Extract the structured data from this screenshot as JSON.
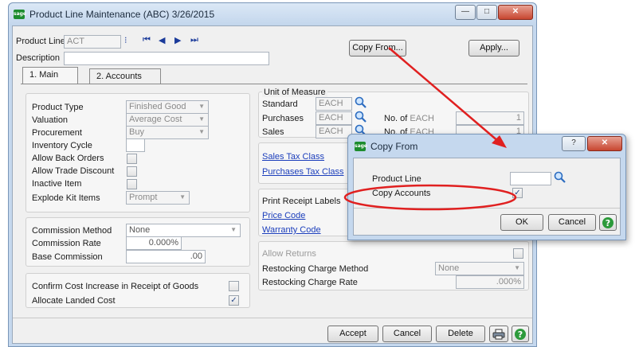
{
  "window": {
    "title": "Product Line Maintenance (ABC) 3/26/2015",
    "minimize": "—",
    "maximize": "□",
    "close": "✕"
  },
  "header": {
    "product_line_label": "Product Line",
    "product_line_value": "ACT",
    "description_label": "Description",
    "description_value": "",
    "copy_from_button": "Copy From...",
    "apply_button": "Apply..."
  },
  "tabs": [
    {
      "label": "1. Main"
    },
    {
      "label": "2. Accounts"
    }
  ],
  "main": {
    "product_type_label": "Product Type",
    "product_type_value": "Finished Good",
    "valuation_label": "Valuation",
    "valuation_value": "Average Cost",
    "procurement_label": "Procurement",
    "procurement_value": "Buy",
    "inventory_cycle_label": "Inventory Cycle",
    "inventory_cycle_value": "",
    "allow_back_orders_label": "Allow Back Orders",
    "allow_back_orders_checked": false,
    "allow_trade_discount_label": "Allow Trade Discount",
    "allow_trade_discount_checked": false,
    "inactive_item_label": "Inactive Item",
    "inactive_item_checked": false,
    "explode_kit_items_label": "Explode Kit Items",
    "explode_kit_items_value": "Prompt",
    "commission_method_label": "Commission Method",
    "commission_method_value": "None",
    "commission_rate_label": "Commission Rate",
    "commission_rate_value": "0.000%",
    "base_commission_label": "Base Commission",
    "base_commission_value": ".00",
    "confirm_cost_label": "Confirm Cost Increase in Receipt of Goods",
    "confirm_cost_checked": false,
    "allocate_landed_cost_label": "Allocate Landed Cost",
    "allocate_landed_cost_checked": true
  },
  "uom": {
    "group_label": "Unit of Measure",
    "standard_label": "Standard",
    "standard_value": "EACH",
    "purchases_label": "Purchases",
    "purchases_value": "EACH",
    "sales_label": "Sales",
    "sales_value": "EACH",
    "no_of_label_1": "No. of",
    "no_of_unit_1": "EACH",
    "no_of_value_1": "1",
    "no_of_label_2": "No. of",
    "no_of_unit_2": "EACH",
    "no_of_value_2": "1"
  },
  "links": {
    "sales_tax_class": "Sales Tax Class",
    "purchases_tax_class": "Purchases Tax Class",
    "print_receipt_labels": "Print Receipt Labels",
    "price_code": "Price Code",
    "warranty_code": "Warranty Code"
  },
  "returns": {
    "allow_returns_label": "Allow Returns",
    "allow_returns_checked": false,
    "restocking_method_label": "Restocking Charge Method",
    "restocking_method_value": "None",
    "restocking_rate_label": "Restocking Charge Rate",
    "restocking_rate_value": ".000%"
  },
  "footer": {
    "accept_button": "Accept",
    "cancel_button": "Cancel",
    "delete_button": "Delete"
  },
  "dialog": {
    "title": "Copy From",
    "help_caption": "?",
    "close_caption": "✕",
    "product_line_label": "Product Line",
    "product_line_value": "",
    "copy_accounts_label": "Copy Accounts",
    "copy_accounts_checked": true,
    "ok_button": "OK",
    "cancel_button": "Cancel"
  },
  "colors": {
    "annotation_red": "#e02020",
    "link_blue": "#1a3dbb",
    "help_green": "#2c9a3a"
  }
}
